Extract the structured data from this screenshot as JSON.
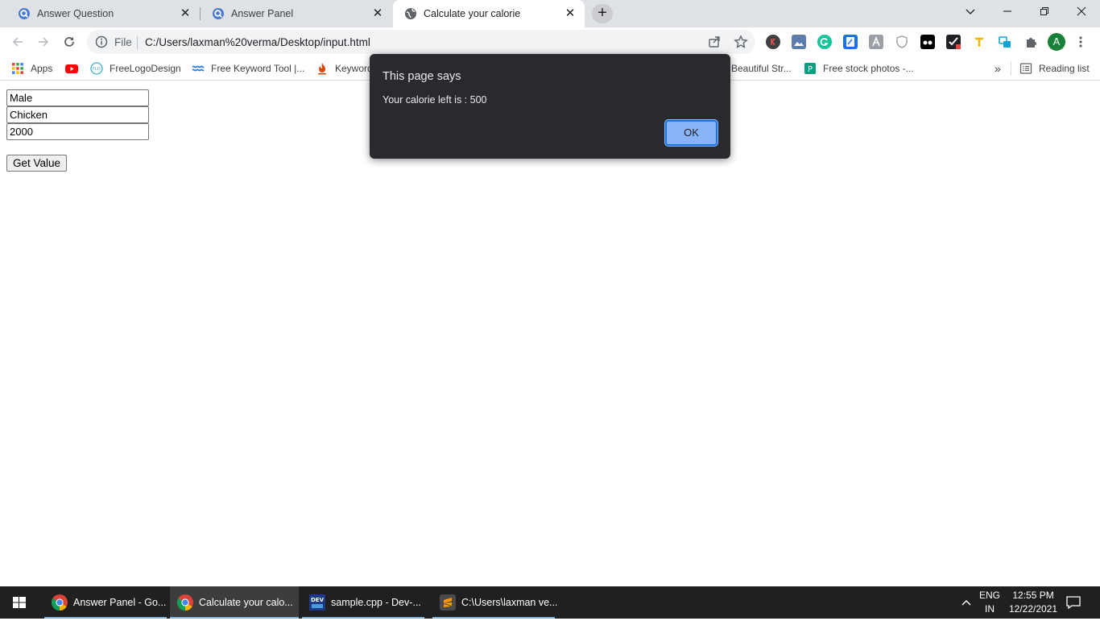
{
  "browser": {
    "tabs": [
      {
        "title": "Answer Question",
        "active": false
      },
      {
        "title": "Answer Panel",
        "active": false
      },
      {
        "title": "Calculate your calorie",
        "active": true
      }
    ],
    "omnibox": {
      "scheme": "File",
      "url": "C:/Users/laxman%20verma/Desktop/input.html"
    },
    "bookmarks": [
      {
        "label": "Apps"
      },
      {
        "label": ""
      },
      {
        "label": "FreeLogoDesign"
      },
      {
        "label": "Free Keyword Tool |..."
      },
      {
        "label": "Keyword"
      },
      {
        "label": "Beautiful Str..."
      },
      {
        "label": "Free stock photos -..."
      }
    ],
    "reading_list": "Reading list",
    "profile_initial": "A",
    "more_bookmarks": "»"
  },
  "page": {
    "fields": [
      {
        "value": "Male"
      },
      {
        "value": "Chicken"
      },
      {
        "value": "2000"
      }
    ],
    "button": "Get Value"
  },
  "alert": {
    "title": "This page says",
    "message": "Your calorie left is : 500",
    "ok": "OK"
  },
  "taskbar": {
    "items": [
      {
        "label": "Answer Panel - Go..."
      },
      {
        "label": "Calculate your calo..."
      },
      {
        "label": "sample.cpp - Dev-..."
      },
      {
        "label": "C:\\Users\\laxman ve..."
      }
    ],
    "lang": "ENG",
    "region": "IN",
    "time": "12:55 PM",
    "date": "12/22/2021"
  },
  "colors": {
    "accent": "#8ab4f8",
    "alert_bg": "#292a2d",
    "taskbar_bg": "#202020"
  }
}
